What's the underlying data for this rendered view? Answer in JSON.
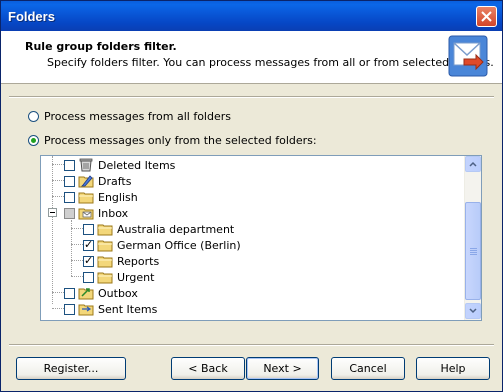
{
  "window": {
    "title": "Folders"
  },
  "header": {
    "title": "Rule group folders filter.",
    "subtitle": "Specify folders filter. You can process messages from all or from selected folders."
  },
  "options": {
    "all_folders": "Process messages from all folders",
    "selected_folders": "Process messages only from the selected folders:",
    "selected": "selected_folders"
  },
  "tree": {
    "items": [
      {
        "label": "Deleted Items",
        "icon": "deleted-items-icon",
        "checked": false
      },
      {
        "label": "Drafts",
        "icon": "drafts-folder-icon",
        "checked": false
      },
      {
        "label": "English",
        "icon": "folder-icon",
        "checked": false
      },
      {
        "label": "Inbox",
        "icon": "inbox-folder-icon",
        "checked": "partial"
      },
      {
        "label": "Australia department",
        "icon": "folder-icon",
        "checked": false
      },
      {
        "label": "German Office (Berlin)",
        "icon": "folder-icon",
        "checked": true
      },
      {
        "label": "Reports",
        "icon": "folder-icon",
        "checked": true
      },
      {
        "label": "Urgent",
        "icon": "folder-icon",
        "checked": false
      },
      {
        "label": "Outbox",
        "icon": "outbox-folder-icon",
        "checked": false
      },
      {
        "label": "Sent Items",
        "icon": "sent-items-icon",
        "checked": false
      }
    ]
  },
  "buttons": {
    "register": "Register...",
    "back": "< Back",
    "next": "Next >",
    "cancel": "Cancel",
    "help": "Help"
  },
  "colors": {
    "titlebar": "#0955d5",
    "accent_radio": "#21a121",
    "close": "#d2452a"
  }
}
